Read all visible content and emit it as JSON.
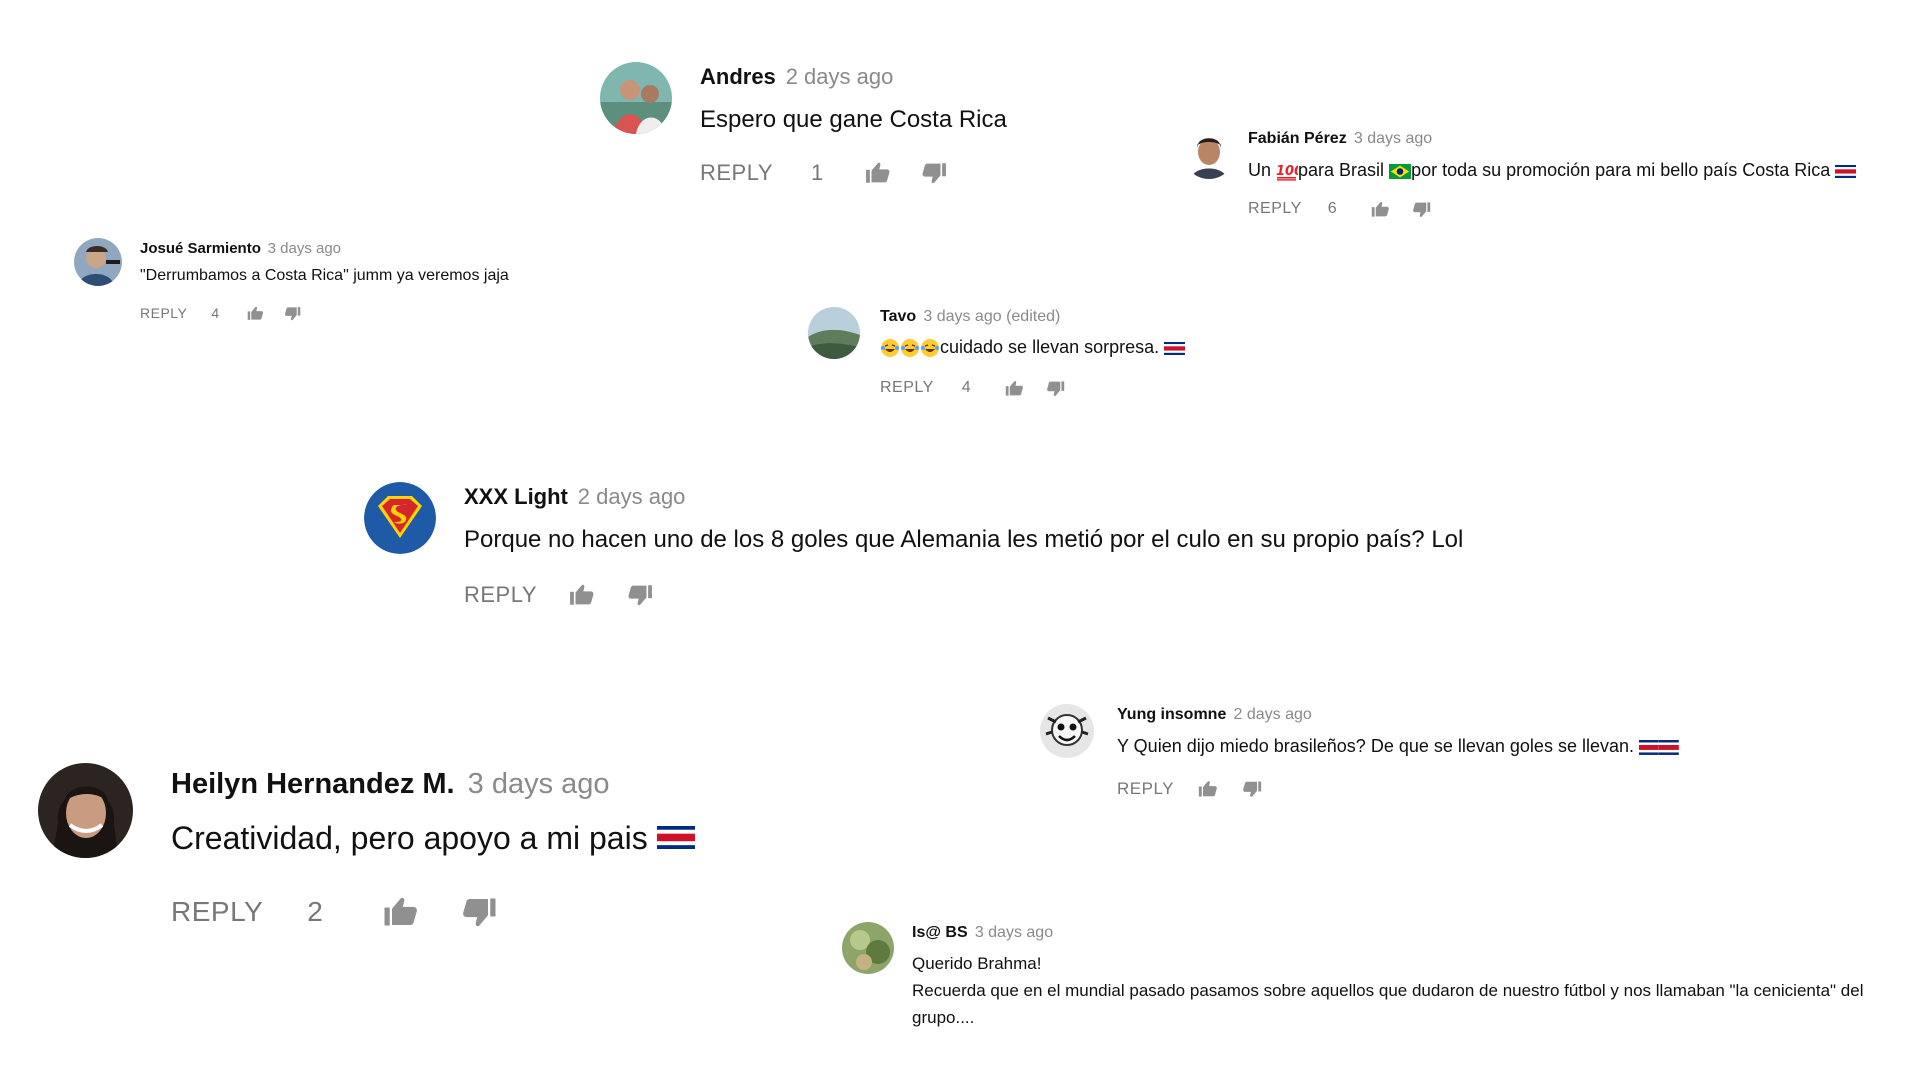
{
  "comments": {
    "andres": {
      "author": "Andres",
      "time": "2 days ago",
      "text": "Espero que gane Costa Rica",
      "reply_label": "REPLY",
      "likes": "1",
      "avatar_icon": "photo-avatar"
    },
    "fabian": {
      "author": "Fabián Pérez",
      "time": "3 days ago",
      "text_a": "Un ",
      "text_b": "para Brasil ",
      "text_c": "por toda su promoción para mi bello país Costa Rica ",
      "reply_label": "REPLY",
      "likes": "6",
      "emoji_icon": "hundred-points-icon"
    },
    "josue": {
      "author": "Josué Sarmiento",
      "time": "3 days ago",
      "text": "\"Derrumbamos a Costa Rica\" jumm ya veremos jaja",
      "reply_label": "REPLY",
      "likes": "4"
    },
    "tavo": {
      "author": "Tavo",
      "time": "3 days ago (edited)",
      "text": "cuidado se llevan sorpresa. ",
      "reply_label": "REPLY",
      "likes": "4",
      "emoji_icon": "laughing-tears-icon"
    },
    "xxx": {
      "author": "XXX Light",
      "time": "2 days ago",
      "text": "Porque no hacen uno de los 8 goles que Alemania les metió por el culo en su propio país? Lol",
      "reply_label": "REPLY",
      "avatar_icon": "superman-shield-icon"
    },
    "yung": {
      "author": "Yung insomne",
      "time": "2 days ago",
      "text": "Y Quien dijo miedo brasileños? De que se llevan goles se llevan. ",
      "reply_label": "REPLY"
    },
    "heilyn": {
      "author": "Heilyn Hernandez M.",
      "time": "3 days ago",
      "text": "Creatividad, pero apoyo a mi pais ",
      "reply_label": "REPLY",
      "likes": "2"
    },
    "isbs": {
      "author": "Is@ BS",
      "time": "3 days ago",
      "line1": "Querido Brahma!",
      "line2": "Recuerda que en el mundial pasado pasamos sobre aquellos que dudaron de nuestro fútbol y nos llamaban \"la cenicienta\" del grupo...."
    }
  },
  "colors": {
    "author": "#111111",
    "meta": "#8a8a8a",
    "action": "#777777",
    "cr_blue": "#002b7f",
    "cr_red": "#ce1126",
    "brazil_green": "#009c3b",
    "brazil_yellow": "#ffdf00"
  }
}
